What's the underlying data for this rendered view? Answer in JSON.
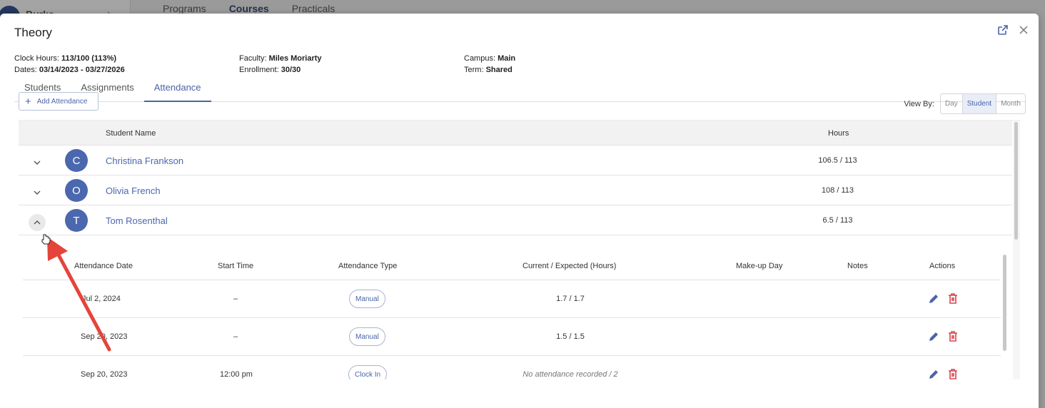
{
  "background": {
    "user_initial": "B",
    "user_name": "Burke",
    "tabs": [
      "Programs",
      "Courses",
      "Practicals"
    ],
    "active_tab": "Courses"
  },
  "modal": {
    "title": "Theory",
    "info": {
      "clock_hours_label": "Clock Hours:",
      "clock_hours_value": "113/100 (113%)",
      "dates_label": "Dates:",
      "dates_value": "03/14/2023 - 03/27/2026",
      "faculty_label": "Faculty:",
      "faculty_value": "Miles Moriarty",
      "enrollment_label": "Enrollment:",
      "enrollment_value": "30/30",
      "campus_label": "Campus:",
      "campus_value": "Main",
      "term_label": "Term:",
      "term_value": "Shared"
    },
    "tabs": [
      {
        "label": "Students"
      },
      {
        "label": "Assignments"
      },
      {
        "label": "Attendance"
      }
    ],
    "active_tab": "Attendance",
    "add_attendance_label": "Add Attendance",
    "view_by": {
      "label": "View By:",
      "options": [
        "Day",
        "Student",
        "Month"
      ],
      "selected": "Student"
    },
    "table": {
      "columns": {
        "student_name": "Student Name",
        "hours": "Hours"
      },
      "rows": [
        {
          "initial": "C",
          "name": "Christina Frankson",
          "hours": "106.5 / 113",
          "expanded": false
        },
        {
          "initial": "O",
          "name": "Olivia French",
          "hours": "108 / 113",
          "expanded": false
        },
        {
          "initial": "T",
          "name": "Tom Rosenthal",
          "hours": "6.5 / 113",
          "expanded": true
        }
      ]
    },
    "detail": {
      "columns": {
        "date": "Attendance Date",
        "start": "Start Time",
        "type": "Attendance Type",
        "current": "Current / Expected (Hours)",
        "makeup": "Make-up Day",
        "notes": "Notes",
        "actions": "Actions"
      },
      "rows": [
        {
          "date": "Jul 2, 2024",
          "start": "–",
          "type": "Manual",
          "current": "1.7 / 1.7"
        },
        {
          "date": "Sep 20, 2023",
          "start": "–",
          "type": "Manual",
          "current": "1.5 / 1.5"
        },
        {
          "date": "Sep 20, 2023",
          "start": "12:00 pm",
          "type": "Clock In",
          "current": "No attendance recorded / 2"
        }
      ]
    }
  },
  "colors": {
    "accent": "#4a64a8",
    "avatar": "#4b68ae",
    "delete": "#d9434b",
    "annotation_arrow": "#e5443b"
  },
  "icons": [
    "open-external-icon",
    "close-icon",
    "plus-icon",
    "chevron-down-icon",
    "chevron-up-icon",
    "pencil-icon",
    "trash-icon",
    "hand-cursor-icon"
  ]
}
